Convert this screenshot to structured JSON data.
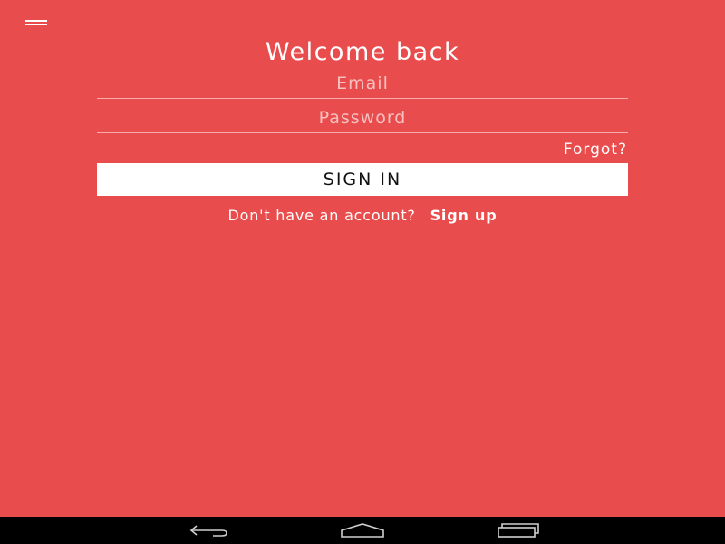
{
  "header": {
    "menu_icon": "hamburger-menu-icon",
    "title": "Welcome back"
  },
  "form": {
    "email_placeholder": "Email",
    "password_placeholder": "Password",
    "forgot_label": "Forgot?",
    "signin_label": "SIGN IN"
  },
  "signup": {
    "prompt": "Don't have an account?",
    "link_label": "Sign up"
  },
  "navbar": {
    "icons": [
      "back-icon",
      "home-icon",
      "recents-icon"
    ]
  },
  "colors": {
    "background": "#e84c4c",
    "button": "#ffffff",
    "navbar": "#000000"
  }
}
